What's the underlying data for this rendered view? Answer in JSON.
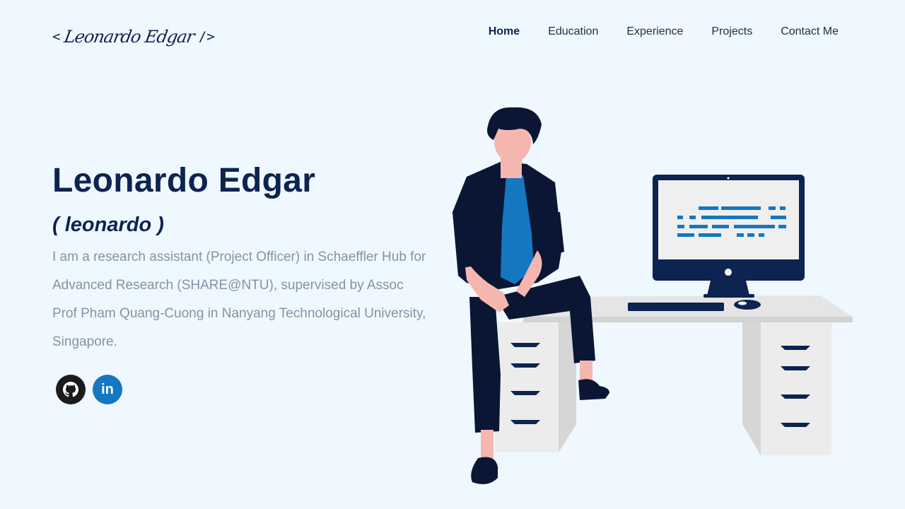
{
  "header": {
    "logo_open": "<",
    "logo_signature": "Leonardo Edgar",
    "logo_close": "/>",
    "nav": [
      {
        "label": "Home",
        "active": true
      },
      {
        "label": "Education",
        "active": false
      },
      {
        "label": "Experience",
        "active": false
      },
      {
        "label": "Projects",
        "active": false
      },
      {
        "label": "Contact Me",
        "active": false
      }
    ]
  },
  "hero": {
    "name": "Leonardo Edgar",
    "nickname": "( leonardo )",
    "bio": "I am a research assistant (Project Officer) in Schaeffler Hub for Advanced Research (SHARE@NTU), supervised by Assoc Prof Pham Quang-Cuong in Nanyang Technological University, Singapore.",
    "socials": [
      {
        "name": "github",
        "icon": "github-icon",
        "color": "#1b1b1b"
      },
      {
        "name": "linkedin",
        "icon": "linkedin-icon",
        "label": "in",
        "color": "#1577c0"
      }
    ]
  },
  "colors": {
    "background": "#eef8fe",
    "primary_text": "#0d2350",
    "muted_text": "#8493a8",
    "accent_blue": "#1577c0"
  }
}
